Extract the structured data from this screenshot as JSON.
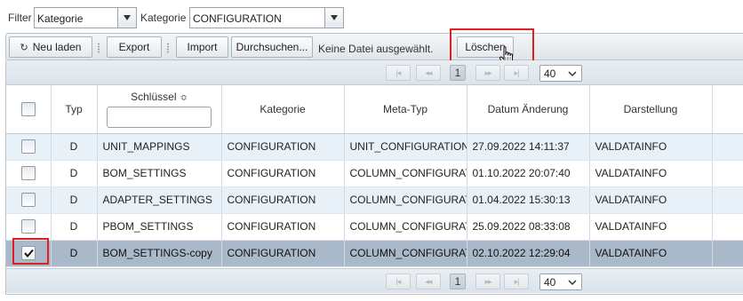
{
  "filter_bar": {
    "filter_label": "Filter",
    "filter_value": "Kategorie",
    "kategorie_label": "Kategorie",
    "kategorie_value": "CONFIGURATION"
  },
  "toolbar": {
    "reload_label": "Neu laden",
    "export_label": "Export",
    "import_label": "Import",
    "browse_label": "Durchsuchen...",
    "no_file_text": "Keine Datei ausgewählt.",
    "delete_label": "Löschen"
  },
  "pager": {
    "first_icon": "first-page-icon",
    "prev_icon": "prev-page-icon",
    "next_icon": "next-page-icon",
    "last_icon": "last-page-icon",
    "first_glyph": "|◂",
    "prev_glyph": "◂◂",
    "next_glyph": "▸▸",
    "last_glyph": "▸|",
    "current_page": "1",
    "page_size": "40"
  },
  "table": {
    "columns": [
      "",
      "Typ",
      "Schlüssel",
      "Kategorie",
      "Meta-Typ",
      "Datum Änderung",
      "Darstellung"
    ],
    "sort_glyph": "≎",
    "rows": [
      {
        "checked": false,
        "typ": "D",
        "key": "UNIT_MAPPINGS",
        "kategorie": "CONFIGURATION",
        "meta_typ": "UNIT_CONFIGURATION",
        "datum": "27.09.2022 14:11:37",
        "darstellung": "VALDATAINFO"
      },
      {
        "checked": false,
        "typ": "D",
        "key": "BOM_SETTINGS",
        "kategorie": "CONFIGURATION",
        "meta_typ": "COLUMN_CONFIGURAT",
        "datum": "01.10.2022 20:07:40",
        "darstellung": "VALDATAINFO"
      },
      {
        "checked": false,
        "typ": "D",
        "key": "ADAPTER_SETTINGS",
        "kategorie": "CONFIGURATION",
        "meta_typ": "COLUMN_CONFIGURAT",
        "datum": "01.04.2022 15:30:13",
        "darstellung": "VALDATAINFO"
      },
      {
        "checked": false,
        "typ": "D",
        "key": "PBOM_SETTINGS",
        "kategorie": "CONFIGURATION",
        "meta_typ": "COLUMN_CONFIGURAT",
        "datum": "25.09.2022 08:33:08",
        "darstellung": "VALDATAINFO"
      },
      {
        "checked": true,
        "typ": "D",
        "key": "BOM_SETTINGS-copy",
        "kategorie": "CONFIGURATION",
        "meta_typ": "COLUMN_CONFIGURAT",
        "datum": "02.10.2022 12:29:04",
        "darstellung": "VALDATAINFO"
      }
    ]
  },
  "colors": {
    "highlight_red": "#e02020",
    "selected_row": "#a9b9c9",
    "alt_row": "#e9f1f8"
  }
}
